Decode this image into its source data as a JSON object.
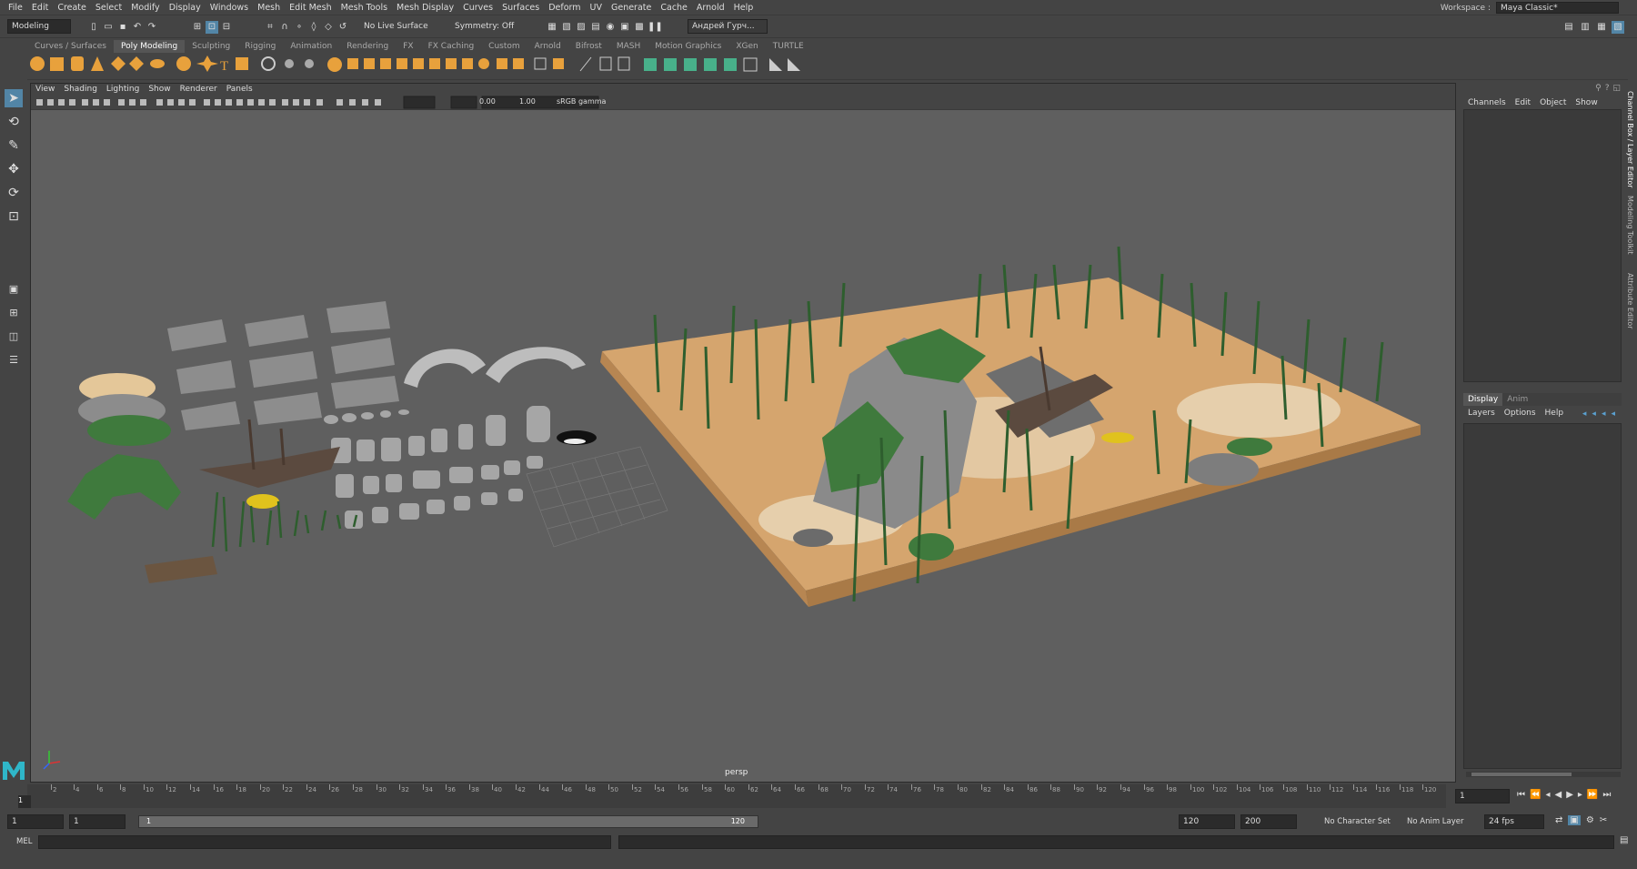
{
  "menubar": {
    "items": [
      "File",
      "Edit",
      "Create",
      "Select",
      "Modify",
      "Display",
      "Windows",
      "Mesh",
      "Edit Mesh",
      "Mesh Tools",
      "Mesh Display",
      "Curves",
      "Surfaces",
      "Deform",
      "UV",
      "Generate",
      "Cache",
      "Arnold",
      "Help"
    ],
    "workspace_label": "Workspace :",
    "workspace_value": "Maya Classic*"
  },
  "statusline": {
    "mode": "Modeling",
    "live_surface": "No Live Surface",
    "symmetry": "Symmetry: Off",
    "user": "Андрей Гурч..."
  },
  "shelf": {
    "tabs": [
      "Curves / Surfaces",
      "Poly Modeling",
      "Sculpting",
      "Rigging",
      "Animation",
      "Rendering",
      "FX",
      "FX Caching",
      "Custom",
      "Arnold",
      "Bifrost",
      "MASH",
      "Motion Graphics",
      "XGen",
      "TURTLE"
    ],
    "active_tab": "Poly Modeling"
  },
  "viewport": {
    "menu": [
      "View",
      "Shading",
      "Lighting",
      "Show",
      "Renderer",
      "Panels"
    ],
    "exposure": "0.00",
    "gamma": "1.00",
    "color_space": "sRGB gamma",
    "camera_label": "persp"
  },
  "channel_box": {
    "menu": [
      "Channels",
      "Edit",
      "Object",
      "Show"
    ]
  },
  "layer_editor": {
    "tabs": [
      "Display",
      "Anim"
    ],
    "menu": [
      "Layers",
      "Options",
      "Help"
    ]
  },
  "side_tabs": [
    "Channel Box / Layer Editor",
    "Modeling Toolkit",
    "Attribute Editor"
  ],
  "timeline": {
    "ticks": [
      "2",
      "4",
      "6",
      "8",
      "10",
      "12",
      "14",
      "16",
      "18",
      "20",
      "22",
      "24",
      "26",
      "28",
      "30",
      "32",
      "34",
      "36",
      "38",
      "40",
      "42",
      "44",
      "46",
      "48",
      "50",
      "52",
      "54",
      "56",
      "58",
      "60",
      "62",
      "64",
      "66",
      "68",
      "70",
      "72",
      "74",
      "76",
      "78",
      "80",
      "82",
      "84",
      "86",
      "88",
      "90",
      "92",
      "94",
      "96",
      "98",
      "100",
      "102",
      "104",
      "106",
      "108",
      "110",
      "112",
      "114",
      "116",
      "118",
      "120"
    ],
    "current_frame": "1",
    "current_frame_field": "1"
  },
  "range": {
    "start": "1",
    "playback_start": "1",
    "slider_start": "1",
    "slider_end": "120",
    "playback_end": "120",
    "end": "200",
    "character_set": "No Character Set",
    "anim_layer": "No Anim Layer",
    "fps": "24 fps"
  },
  "command": {
    "label": "MEL"
  },
  "colors": {
    "accent": "#5285a6",
    "shelf_icon": "#e8a13c",
    "shelf_green": "#48b08a",
    "sand": "#d5a56e",
    "plant": "#3f7a3d"
  }
}
